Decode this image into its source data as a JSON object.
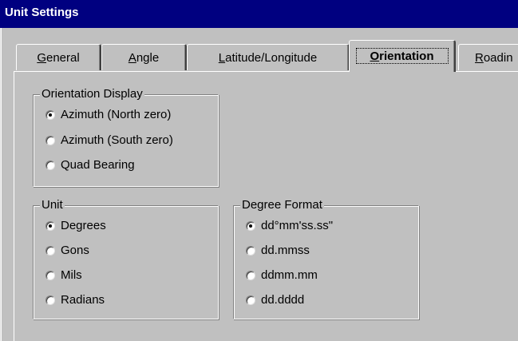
{
  "window": {
    "title": "Unit Settings"
  },
  "tabs": [
    {
      "label": "General",
      "underline_char": "G",
      "rest": "eneral",
      "active": false
    },
    {
      "label": "Angle",
      "underline_char": "A",
      "rest": "ngle",
      "active": false
    },
    {
      "label": "Latitude/Longitude",
      "underline_char": "L",
      "rest": "atitude/Longitude",
      "active": false
    },
    {
      "label": "Orientation",
      "underline_char": "O",
      "rest": "rientation",
      "active": true
    },
    {
      "label": "Roadin",
      "underline_char": "R",
      "rest": "oadin",
      "active": false
    }
  ],
  "orientation_display": {
    "label": "Orientation Display",
    "options": [
      {
        "label": "Azimuth (North zero)",
        "checked": true
      },
      {
        "label": "Azimuth (South zero)",
        "checked": false
      },
      {
        "label": "Quad Bearing",
        "checked": false
      }
    ]
  },
  "unit": {
    "label": "Unit",
    "options": [
      {
        "label": "Degrees",
        "checked": true
      },
      {
        "label": "Gons",
        "checked": false
      },
      {
        "label": "Mils",
        "checked": false
      },
      {
        "label": "Radians",
        "checked": false
      }
    ]
  },
  "degree_format": {
    "label": "Degree Format",
    "options": [
      {
        "label": "dd°mm'ss.ss\"",
        "checked": true
      },
      {
        "label": "dd.mmss",
        "checked": false
      },
      {
        "label": "ddmm.mm",
        "checked": false
      },
      {
        "label": "dd.dddd",
        "checked": false
      }
    ]
  },
  "colors": {
    "titlebar": "#000080",
    "face": "#c0c0c0",
    "highlight": "#ffffff",
    "shadow": "#808080"
  }
}
